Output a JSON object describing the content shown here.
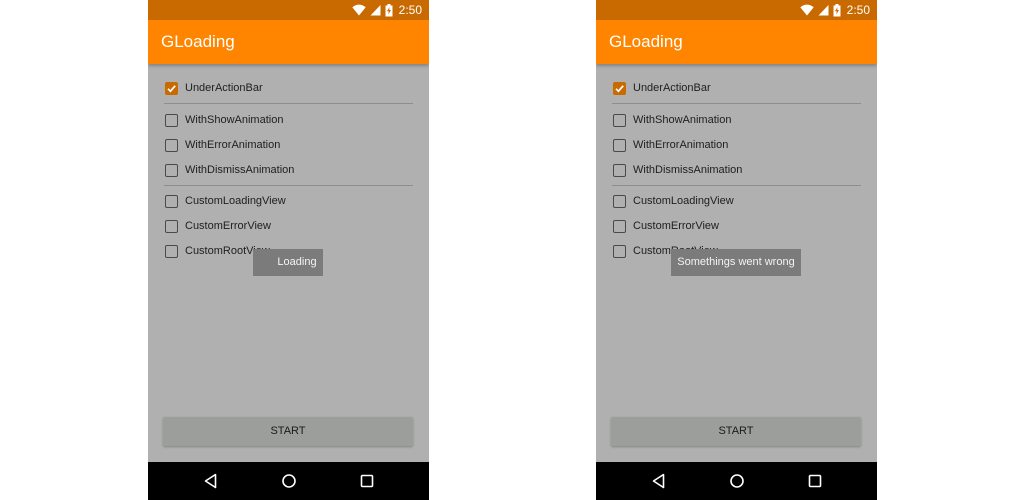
{
  "screens": [
    {
      "status": {
        "time": "2:50"
      },
      "app_title": "GLoading",
      "options": [
        {
          "label": "UnderActionBar",
          "checked": true
        },
        {
          "label": "WithShowAnimation",
          "checked": false
        },
        {
          "label": "WithErrorAnimation",
          "checked": false
        },
        {
          "label": "WithDismissAnimation",
          "checked": false
        },
        {
          "label": "CustomLoadingView",
          "checked": false
        },
        {
          "label": "CustomErrorView",
          "checked": false
        },
        {
          "label": "CustomRootView",
          "checked": false
        }
      ],
      "toast": "Loading",
      "start_button": "START"
    },
    {
      "status": {
        "time": "2:50"
      },
      "app_title": "GLoading",
      "options": [
        {
          "label": "UnderActionBar",
          "checked": true
        },
        {
          "label": "WithShowAnimation",
          "checked": false
        },
        {
          "label": "WithErrorAnimation",
          "checked": false
        },
        {
          "label": "WithDismissAnimation",
          "checked": false
        },
        {
          "label": "CustomLoadingView",
          "checked": false
        },
        {
          "label": "CustomErrorView",
          "checked": false
        },
        {
          "label": "CustomRootView",
          "checked": false
        }
      ],
      "toast": "Somethings went wrong",
      "start_button": "START"
    }
  ],
  "colors": {
    "status_bar": "#c96a00",
    "action_bar": "#ff8400",
    "content_bg": "#b0b0b0",
    "checkbox_accent": "#c96a00"
  },
  "icons": {
    "status": [
      "wifi-icon",
      "signal-icon",
      "battery-charging-icon"
    ],
    "nav": [
      "back-icon",
      "home-icon",
      "recents-icon"
    ]
  }
}
